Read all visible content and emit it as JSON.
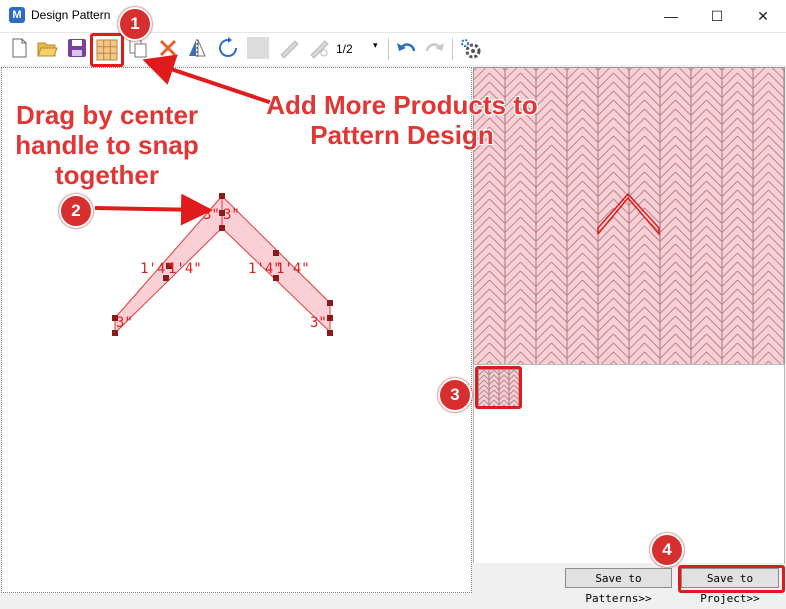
{
  "window": {
    "title": "Design Pattern",
    "logo_letter": "M",
    "minimize": "—",
    "maximize": "☐",
    "close": "✕"
  },
  "toolbar": {
    "page_indicator": "1/2",
    "page_dropdown_arrow": "▾",
    "icons": [
      "new-file-icon",
      "open-folder-icon",
      "save-icon",
      "add-products-grid-icon",
      "copy-icon",
      "delete-icon",
      "mirror-icon",
      "rotate-icon",
      "blank-tool-icon",
      "saw-icon",
      "saw-alt-icon",
      "undo-icon",
      "redo-icon",
      "settings-icon"
    ]
  },
  "canvas": {
    "dimension_labels": [
      "3\"",
      "3\"",
      "1'4\"",
      "1'4\"",
      "1'4\"",
      "1'4\"",
      "3\"",
      "3\""
    ]
  },
  "buttons": {
    "save_to_patterns": "Save to Patterns>>",
    "save_to_project": "Save to Project>>"
  },
  "annotations": {
    "callout_left": "Drag by center handle to snap together",
    "callout_right": "Add More Products to Pattern Design",
    "badge_1": "1",
    "badge_2": "2",
    "badge_3": "3",
    "badge_4": "4"
  },
  "colors": {
    "accent_red": "#e01b1b",
    "tile_fill": "#f7d0d6",
    "tile_stroke": "#e03a3a"
  }
}
